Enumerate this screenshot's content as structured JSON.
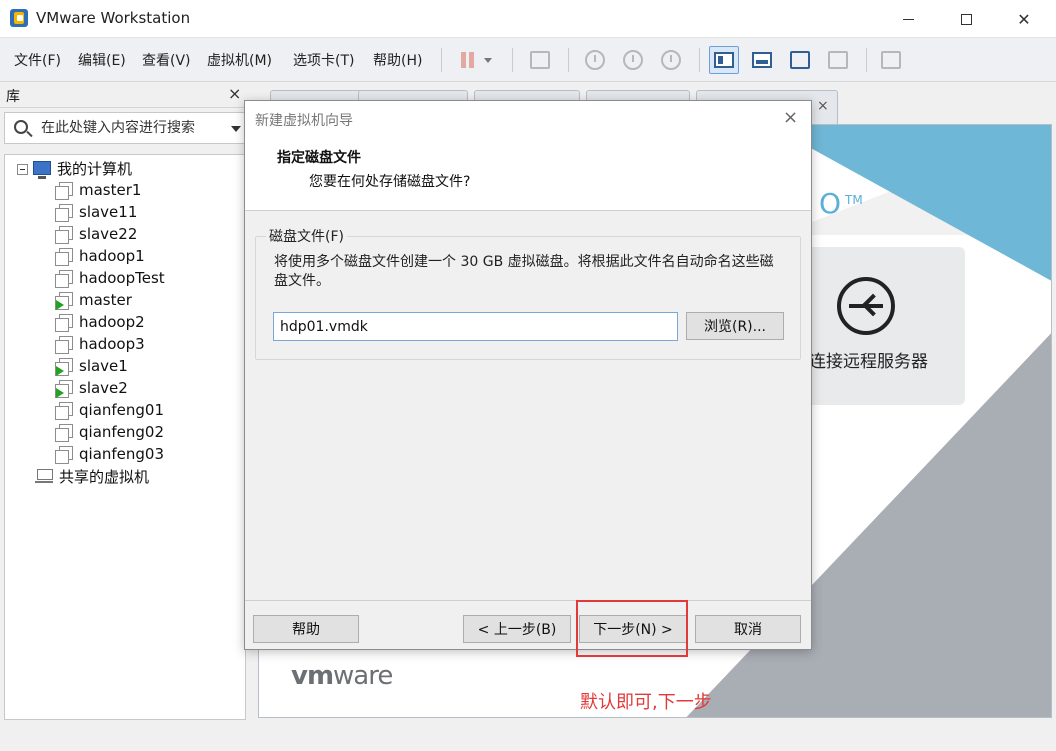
{
  "window": {
    "title": "VMware Workstation"
  },
  "menu": {
    "items": [
      "文件(F)",
      "编辑(E)",
      "查看(V)",
      "虚拟机(M)",
      "选项卡(T)",
      "帮助(H)"
    ]
  },
  "library": {
    "title": "库",
    "close": "×",
    "search_placeholder": "在此处键入内容进行搜索",
    "root": "我的计算机",
    "vms": [
      {
        "name": "master1",
        "running": false
      },
      {
        "name": "slave11",
        "running": false
      },
      {
        "name": "slave22",
        "running": false
      },
      {
        "name": "hadoop1",
        "running": false
      },
      {
        "name": "hadoopTest",
        "running": false
      },
      {
        "name": "master",
        "running": true
      },
      {
        "name": "hadoop2",
        "running": false
      },
      {
        "name": "hadoop3",
        "running": false
      },
      {
        "name": "slave1",
        "running": true
      },
      {
        "name": "slave2",
        "running": true
      },
      {
        "name": "qianfeng01",
        "running": false
      },
      {
        "name": "qianfeng02",
        "running": false
      },
      {
        "name": "qianfeng03",
        "running": false
      }
    ],
    "shared": "共享的虚拟机"
  },
  "home": {
    "tab_close": "×",
    "tm_mark": "O",
    "tm_sup": "TM",
    "remote_label": "连接远程服务器",
    "logo_bold": "vm",
    "logo_light": "ware"
  },
  "dialog": {
    "title": "新建虚拟机向导",
    "close": "×",
    "heading": "指定磁盘文件",
    "subheading": "您要在何处存储磁盘文件?",
    "group_label": "磁盘文件(F)",
    "description": "将使用多个磁盘文件创建一个 30 GB 虚拟磁盘。将根据此文件名自动命名这些磁盘文件。",
    "file_value": "hdp01.vmdk",
    "browse": "浏览(R)...",
    "help": "帮助",
    "back": "< 上一步(B)",
    "next": "下一步(N) >",
    "cancel": "取消"
  },
  "annotation": {
    "text": "默认即可,下一步",
    "color": "#e23a3a"
  }
}
